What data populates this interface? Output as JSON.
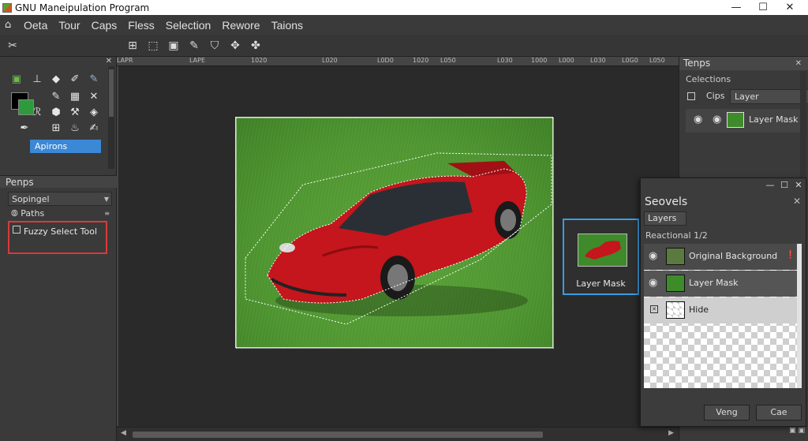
{
  "window": {
    "title": "GNU Maneipulation Program",
    "controls": [
      "—",
      "☐",
      "✕"
    ]
  },
  "menu": [
    "Oeta",
    "Tour",
    "Caps",
    "Fless",
    "Selection",
    "Rewore",
    "Taions"
  ],
  "toolbox": {
    "options_label": "Apirons"
  },
  "ruler": {
    "ticks": [
      "LAPR",
      "LAPE",
      "1020",
      "L020",
      "L0D0",
      "1020",
      "L050",
      "L030",
      "1000",
      "L000",
      "L030",
      "L0G0",
      "L050"
    ]
  },
  "panel2": {
    "title": "Penps",
    "dropdown": "Sopingel",
    "paths": "Paths",
    "fuzzy": "Fuzzy Select Tool"
  },
  "thumbnail": {
    "label": "Layer Mask"
  },
  "right_panel": {
    "title": "Tenps",
    "subtitle": "Celections",
    "caps": "Cips",
    "dropdown": "Layer",
    "layer_label": "Layer Mask"
  },
  "dialog": {
    "title": "Seovels",
    "tab": "Layers",
    "subtitle": "Reactional 1/2",
    "layers": [
      {
        "name": "Original Background"
      },
      {
        "name": "Layer Mask"
      },
      {
        "name": "Hide"
      }
    ],
    "buttons": {
      "ok": "Veng",
      "cancel": "Cae"
    }
  },
  "colors": {
    "accent": "#3a9de0",
    "highlight": "#d83a3a",
    "selection": "#3b88d6"
  }
}
